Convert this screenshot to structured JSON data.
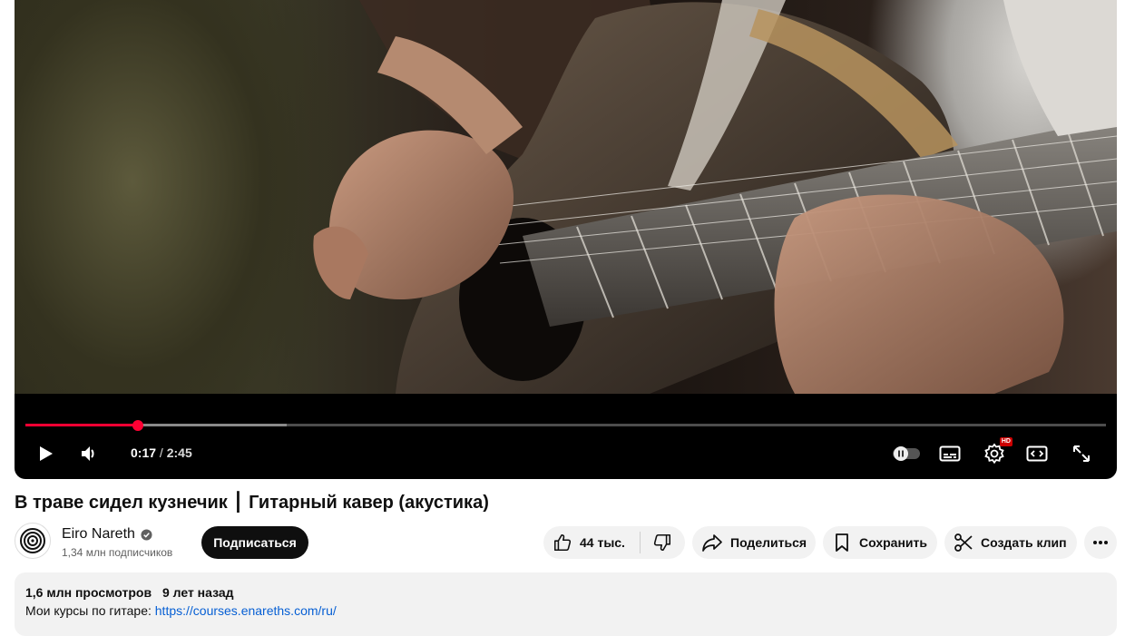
{
  "player": {
    "current_time": "0:17",
    "separator": "/",
    "duration": "2:45",
    "played_fraction": 0.104,
    "buffered_fraction": 0.242,
    "hd_badge": "HD",
    "colors": {
      "progress": "#ff0033",
      "buffer": "#8a8a8a",
      "track": "#4d4d4d"
    },
    "icons": [
      "play-icon",
      "volume-icon",
      "autoplay-toggle-icon",
      "subtitles-icon",
      "settings-icon",
      "theater-mode-icon",
      "fullscreen-icon"
    ]
  },
  "video": {
    "title": "В траве сидел кузнечик ⎮ Гитарный кавер (акустика)"
  },
  "channel": {
    "name": "Eiro Nareth",
    "subscribers": "1,34 млн подписчиков",
    "subscribe_label": "Подписаться"
  },
  "actions": {
    "likes": "44 тыс.",
    "share_label": "Поделиться",
    "save_label": "Сохранить",
    "clip_label": "Создать клип"
  },
  "description": {
    "views": "1,6 млн просмотров",
    "age": "9 лет назад",
    "text_prefix": "Мои курсы по гитаре:",
    "link": "https://courses.enareths.com/ru/",
    "background": "#f2f2f2",
    "link_color": "#065fd4"
  }
}
